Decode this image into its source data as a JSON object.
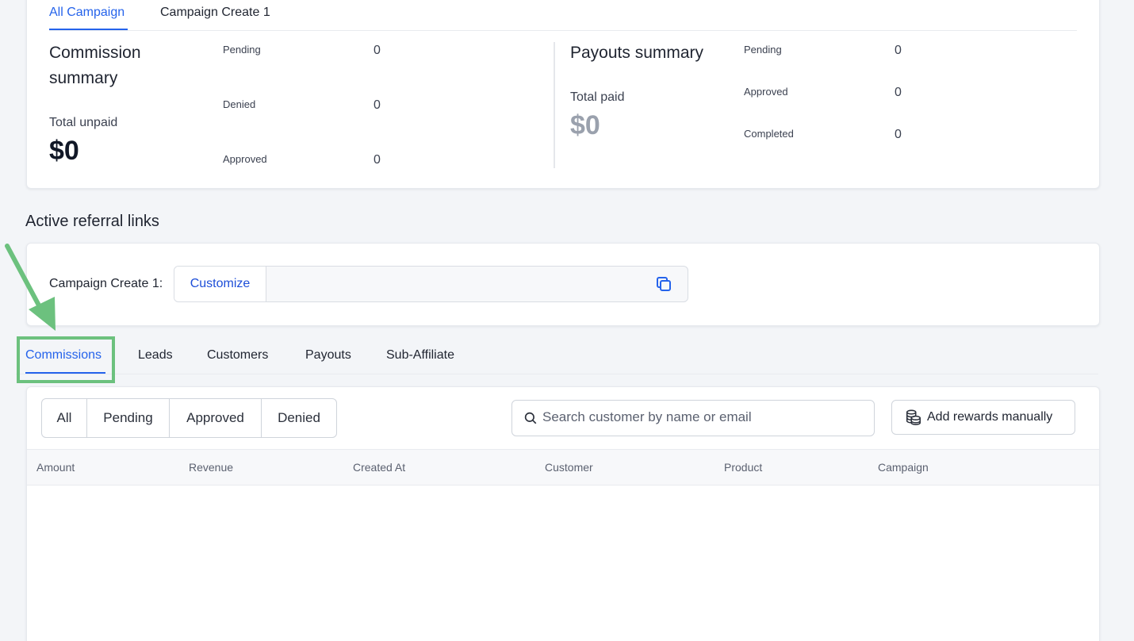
{
  "campaign_tabs": {
    "all": "All Campaign",
    "create1": "Campaign Create 1"
  },
  "commission_summary": {
    "title": "Commission summary",
    "total_label": "Total unpaid",
    "total_value": "$0",
    "stats": [
      {
        "label": "Pending",
        "value": "0"
      },
      {
        "label": "Denied",
        "value": "0"
      },
      {
        "label": "Approved",
        "value": "0"
      }
    ]
  },
  "payouts_summary": {
    "title": "Payouts summary",
    "total_label": "Total paid",
    "total_value": "$0",
    "stats": [
      {
        "label": "Pending",
        "value": "0"
      },
      {
        "label": "Approved",
        "value": "0"
      },
      {
        "label": "Completed",
        "value": "0"
      }
    ]
  },
  "referral": {
    "section_title": "Active referral links",
    "campaign_label": "Campaign Create 1:",
    "customize_label": "Customize",
    "link_value": ""
  },
  "page_tabs": [
    "Commissions",
    "Leads",
    "Customers",
    "Payouts",
    "Sub-Affiliate"
  ],
  "filters": [
    "All",
    "Pending",
    "Approved",
    "Denied"
  ],
  "search": {
    "placeholder": "Search customer by name or email"
  },
  "add_rewards_label": "Add rewards manually",
  "table": {
    "headers": [
      "Amount",
      "Revenue",
      "Created At",
      "Customer",
      "Product",
      "Campaign"
    ]
  },
  "colors": {
    "accent": "#2563eb",
    "highlight": "#6cc17e",
    "muted_total": "#9aa1ad"
  },
  "icons": [
    "copy-icon",
    "search-icon",
    "coins-icon"
  ]
}
